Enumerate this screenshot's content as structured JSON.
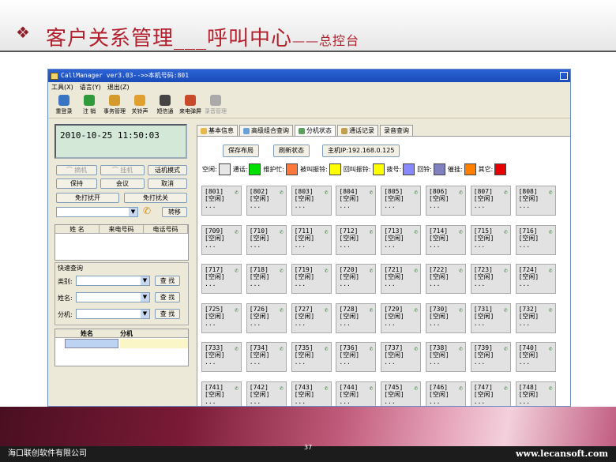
{
  "slide": {
    "bullet_icon": "diamond-bullet-icon",
    "title_main": "客户关系管理___呼叫中心",
    "title_sub": "——总控台",
    "page_number": "37",
    "company": "海口联创软件有限公司",
    "website": "www.lecansoft.com"
  },
  "window": {
    "title": "CallManager ver3.03-->>本机号码:801",
    "menu": [
      "工具(X)",
      "语言(Y)",
      "退出(Z)"
    ],
    "toolbar": [
      {
        "label": "重登录",
        "icon": "relogin-icon",
        "color": "#3a75c4"
      },
      {
        "label": "注 销",
        "icon": "logout-icon",
        "color": "#2e9a3a"
      },
      {
        "label": "事务管理",
        "icon": "task-icon",
        "color": "#d49a2a"
      },
      {
        "label": "关铃声",
        "icon": "speaker-icon",
        "color": "#e0a030"
      },
      {
        "label": "短信通",
        "icon": "sms-icon",
        "color": "#444444"
      },
      {
        "label": "来电弹屏",
        "icon": "popup-icon",
        "color": "#c84a2a"
      },
      {
        "label": "录音管理",
        "icon": "record-icon",
        "color": "#aaaaaa"
      }
    ]
  },
  "left": {
    "clock": "2010-10-25 11:50:03",
    "btn_pickup": "摘机",
    "btn_hangup": "挂机",
    "btn_mode": "话机模式",
    "btn_hold": "保持",
    "btn_conf": "会议",
    "btn_cancel": "取消",
    "btn_dnd_on": "免打扰开",
    "btn_dnd_off": "免打扰关",
    "btn_transfer": "转移",
    "grid_cols": [
      "姓 名",
      "来电号码",
      "电话号码"
    ],
    "quick_title": "快速查询",
    "q_type": "类别:",
    "q_name": "姓名:",
    "q_ext": "分机:",
    "btn_search": "查 找",
    "grid2_cols": [
      "姓名",
      "分机"
    ]
  },
  "tabs": [
    "基本信息",
    "高级组合查询",
    "分机状态",
    "通话记录",
    "录音查询"
  ],
  "status": {
    "btn_save": "保存布局",
    "btn_refresh": "刷新状态",
    "host": "主机IP:192.168.0.125",
    "legend": [
      {
        "label": "空闲:",
        "color": "#e6e6e6"
      },
      {
        "label": "通话:",
        "color": "#00e000"
      },
      {
        "label": "维护忙:",
        "color": "#ff7a3a"
      },
      {
        "label": "被叫振铃:",
        "color": "#ffff00"
      },
      {
        "label": "回叫振铃:",
        "color": "#ffff00"
      },
      {
        "label": "拨号:",
        "color": "#8888ff"
      },
      {
        "label": "回铃:",
        "color": "#8080c0"
      },
      {
        "label": "催挂:",
        "color": "#ff8000"
      },
      {
        "label": "其它:",
        "color": "#e60000"
      }
    ],
    "extensions": [
      "801",
      "802",
      "803",
      "804",
      "805",
      "806",
      "807",
      "808",
      "709",
      "710",
      "711",
      "712",
      "713",
      "714",
      "715",
      "716",
      "717",
      "718",
      "719",
      "720",
      "721",
      "722",
      "723",
      "724",
      "725",
      "726",
      "727",
      "728",
      "729",
      "730",
      "731",
      "732",
      "733",
      "734",
      "735",
      "736",
      "737",
      "738",
      "739",
      "740",
      "741",
      "742",
      "743",
      "744",
      "745",
      "746",
      "747",
      "748"
    ],
    "idle_label": "[空闲]",
    "dots": "..."
  }
}
